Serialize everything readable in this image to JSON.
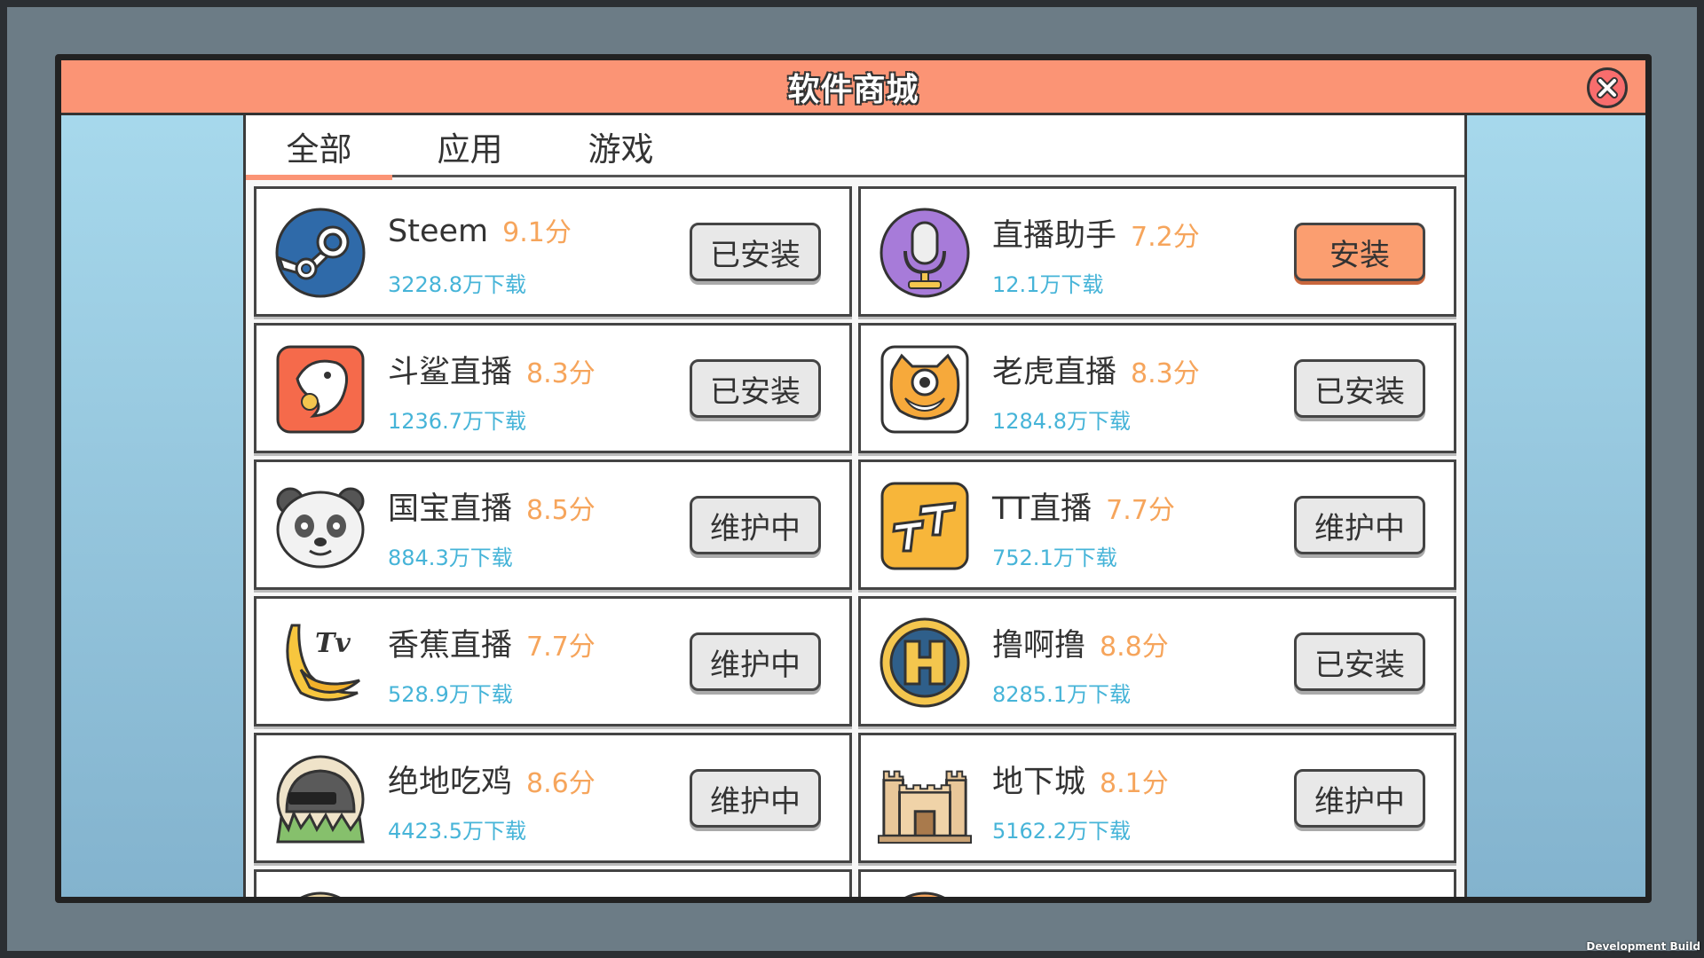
{
  "window": {
    "title": "软件商城"
  },
  "tabs": [
    {
      "label": "全部"
    },
    {
      "label": "应用"
    },
    {
      "label": "游戏"
    }
  ],
  "apps": [
    {
      "name": "Steem",
      "score": "9.1分",
      "downloads": "3228.8万下载",
      "action": "已安装",
      "icon": "steam-icon"
    },
    {
      "name": "直播助手",
      "score": "7.2分",
      "downloads": "12.1万下载",
      "action": "安装",
      "icon": "microphone-icon"
    },
    {
      "name": "斗鲨直播",
      "score": "8.3分",
      "downloads": "1236.7万下载",
      "action": "已安装",
      "icon": "shark-icon"
    },
    {
      "name": "老虎直播",
      "score": "8.3分",
      "downloads": "1284.8万下载",
      "action": "已安装",
      "icon": "tiger-icon"
    },
    {
      "name": "国宝直播",
      "score": "8.5分",
      "downloads": "884.3万下载",
      "action": "维护中",
      "icon": "panda-icon"
    },
    {
      "name": "TT直播",
      "score": "7.7分",
      "downloads": "752.1万下载",
      "action": "维护中",
      "icon": "tt-icon"
    },
    {
      "name": "香蕉直播",
      "score": "7.7分",
      "downloads": "528.9万下载",
      "action": "维护中",
      "icon": "banana-tv-icon"
    },
    {
      "name": "撸啊撸",
      "score": "8.8分",
      "downloads": "8285.1万下载",
      "action": "已安装",
      "icon": "h-shield-icon"
    },
    {
      "name": "绝地吃鸡",
      "score": "8.6分",
      "downloads": "4423.5万下载",
      "action": "维护中",
      "icon": "helmet-icon"
    },
    {
      "name": "地下城",
      "score": "8.1分",
      "downloads": "5162.2万下载",
      "action": "维护中",
      "icon": "castle-icon"
    }
  ],
  "footer": {
    "dev_build": "Development Build"
  },
  "colors": {
    "title_bar": "#fb9475",
    "score": "#f6a55c",
    "downloads": "#46b4d8",
    "install_button": "#fb9e70"
  }
}
